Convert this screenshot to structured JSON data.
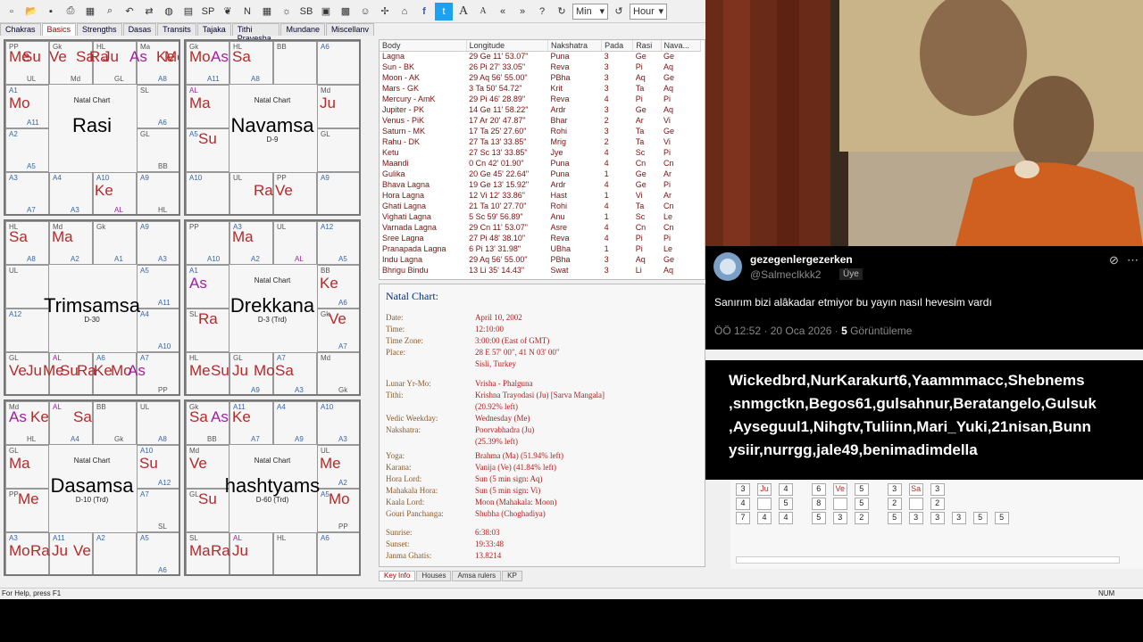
{
  "toolbar": {
    "min_select": "Min",
    "hour_select": "Hour",
    "buttons": [
      "new-icon",
      "open-icon",
      "save-icon",
      "print-icon",
      "palette-icon",
      "search-icon",
      "undo-icon",
      "compare-icon",
      "globe-icon",
      "grid-icon",
      "sp-kb-icon",
      "leaf-icon",
      "n-icon",
      "table-icon",
      "sun-icon",
      "sb-icon",
      "frame-icon",
      "pattern-icon",
      "people-icon",
      "pinwheel-icon",
      "house-icon",
      "facebook-icon",
      "twitter-icon",
      "font-large-icon",
      "font-small-icon",
      "rewind-icon",
      "forward-icon",
      "help-icon",
      "cycle-icon",
      "cycle2-icon"
    ]
  },
  "tabs": [
    "Chakras",
    "Basics",
    "Strengths",
    "Dasas",
    "Transits",
    "Tajaka",
    "Tithi Pravesha",
    "Mundane",
    "Miscellanv"
  ],
  "active_tab": "Basics",
  "charts": [
    {
      "title": "Natal Chart",
      "name": "Rasi",
      "sub": ""
    },
    {
      "title": "Natal Chart",
      "name": "Navamsa",
      "sub": "D-9"
    },
    {
      "title": "",
      "name": "Trimsamsa",
      "sub": "D-30"
    },
    {
      "title": "Natal Chart",
      "name": "Drekkana",
      "sub": "D-3 (Trd)"
    },
    {
      "title": "Natal Chart",
      "name": "Dasamsa",
      "sub": "D-10 (Trd)"
    },
    {
      "title": "Natal Chart",
      "name": "hashtyams",
      "sub": "D-60 (Trd)"
    }
  ],
  "chart_planets": {
    "c0": [
      [
        "0",
        "0",
        "Me",
        "big"
      ],
      [
        "0",
        "1",
        "Su",
        "big"
      ],
      [
        "0",
        "3",
        "Ve",
        "big"
      ],
      [
        "0",
        "5",
        "Sa",
        "big"
      ],
      [
        "0",
        "6",
        "Ra",
        "big"
      ],
      [
        "0",
        "7",
        "Ju",
        "big"
      ],
      [
        "0",
        "9",
        "As",
        "bigp"
      ],
      [
        "0",
        "11",
        "Ke",
        "big"
      ],
      [
        "0",
        "12",
        "Me",
        "big"
      ],
      [
        "1",
        "0",
        "Mo",
        "big"
      ],
      [
        "2",
        "4",
        "Ke",
        "big"
      ]
    ],
    "c1": [
      [
        "0",
        "0",
        "Mo",
        "big"
      ],
      [
        "0",
        "1",
        "As",
        "bigp"
      ],
      [
        "0",
        "2",
        "Sa",
        "big"
      ],
      [
        "1",
        "0",
        "Ma",
        "big"
      ],
      [
        "1",
        "1",
        "Ju",
        "big"
      ],
      [
        "1",
        "2",
        "Su",
        "big"
      ],
      [
        "2",
        "3",
        "Ra",
        "big"
      ],
      [
        "2",
        "4",
        "Ve",
        "big"
      ]
    ],
    "c2": [
      [
        "0",
        "0",
        "Sa",
        "big"
      ],
      [
        "0",
        "2",
        "Ma",
        "big"
      ],
      [
        "2",
        "0",
        "Ve",
        "big"
      ],
      [
        "2",
        "1",
        "Ju",
        "big"
      ],
      [
        "2",
        "2",
        "Me",
        "big"
      ],
      [
        "2",
        "3",
        "Su",
        "big"
      ],
      [
        "2",
        "4",
        "Ra",
        "big"
      ],
      [
        "2",
        "5",
        "Ke",
        "big"
      ],
      [
        "2",
        "6",
        "Mo",
        "big"
      ],
      [
        "2",
        "7",
        "As",
        "bigp"
      ]
    ],
    "c3": [
      [
        "0",
        "2",
        "Ma",
        "big"
      ],
      [
        "1",
        "0",
        "As",
        "bigp"
      ],
      [
        "1",
        "1",
        "Ke",
        "big"
      ],
      [
        "1",
        "2",
        "Ra",
        "big"
      ],
      [
        "1",
        "3",
        "Ve",
        "big"
      ],
      [
        "2",
        "0",
        "Me",
        "big"
      ],
      [
        "2",
        "1",
        "Su",
        "big"
      ],
      [
        "2",
        "2",
        "Ju",
        "big"
      ],
      [
        "2",
        "3",
        "Mo",
        "big"
      ],
      [
        "2",
        "4",
        "Sa",
        "big"
      ]
    ],
    "c4": [
      [
        "0",
        "0",
        "As",
        "bigp"
      ],
      [
        "0",
        "1",
        "Ke",
        "big"
      ],
      [
        "0",
        "3",
        "Sa",
        "big"
      ],
      [
        "1",
        "0",
        "Ma",
        "big"
      ],
      [
        "1",
        "1",
        "Su",
        "big"
      ],
      [
        "1",
        "2",
        "Me",
        "big"
      ],
      [
        "2",
        "0",
        "Mo",
        "big"
      ],
      [
        "2",
        "1",
        "Ra",
        "big"
      ],
      [
        "2",
        "2",
        "Ju",
        "big"
      ],
      [
        "2",
        "3",
        "Ve",
        "big"
      ]
    ],
    "c5": [
      [
        "0",
        "0",
        "Sa",
        "big"
      ],
      [
        "0",
        "1",
        "As",
        "bigp"
      ],
      [
        "0",
        "2",
        "Ke",
        "big"
      ],
      [
        "1",
        "0",
        "Ve",
        "big"
      ],
      [
        "1",
        "1",
        "Me",
        "big"
      ],
      [
        "1",
        "2",
        "Su",
        "big"
      ],
      [
        "1",
        "3",
        "Mo",
        "big"
      ],
      [
        "2",
        "0",
        "Ma",
        "big"
      ],
      [
        "2",
        "1",
        "Ra",
        "big"
      ],
      [
        "2",
        "2",
        "Ju",
        "big"
      ]
    ]
  },
  "chart_small": {
    "c0": [
      "PP",
      "Gk",
      "HL",
      "Ma",
      "SL",
      "GL",
      "A9",
      "A10",
      "A4",
      "A3",
      "A2",
      "A1",
      "UL",
      "Md",
      "GL",
      "A8",
      "A6",
      "BB",
      "HL",
      "AL",
      "A3",
      "A7",
      "A5",
      "A11"
    ],
    "c1": [
      "Gk",
      "HL",
      "BB",
      "A6",
      "Md",
      "GL",
      "A9",
      "PP",
      "UL",
      "A10",
      "A5",
      "AL",
      "A11",
      "A8"
    ],
    "c2": [
      "HL",
      "Md",
      "Gk",
      "A9",
      "A5",
      "A4",
      "A7",
      "A6",
      "AL",
      "GL",
      "A12",
      "UL",
      "A8",
      "A2",
      "A1",
      "A3",
      "A11",
      "A10",
      "PP"
    ],
    "c3": [
      "PP",
      "A3",
      "UL",
      "A12",
      "BB",
      "Gk",
      "Md",
      "A7",
      "GL",
      "HL",
      "SL",
      "A1",
      "A10",
      "A2",
      "AL",
      "A5",
      "A6",
      "A7",
      "Gk",
      "A3",
      "A9"
    ],
    "c4": [
      "Md",
      "AL",
      "BB",
      "UL",
      "A10",
      "A7",
      "A5",
      "A2",
      "A11",
      "A3",
      "PP",
      "GL",
      "HL",
      "A4",
      "Gk",
      "A8",
      "A12",
      "SL",
      "A6"
    ],
    "c5": [
      "Gk",
      "A11",
      "A4",
      "A10",
      "UL",
      "A5",
      "A6",
      "HL",
      "AL",
      "SL",
      "GL",
      "Md",
      "BB",
      "A7",
      "A9",
      "A3",
      "A2",
      "PP"
    ]
  },
  "table": {
    "headers": [
      "Body",
      "Longitude",
      "Nakshatra",
      "Pada",
      "Rasi",
      "Nava..."
    ],
    "rows": [
      [
        "Lagna",
        "29 Ge 11' 53.07\"",
        "Puna",
        "3",
        "Ge",
        "Ge"
      ],
      [
        "Sun - BK",
        "26 Pi 27' 33.05\"",
        "Reva",
        "3",
        "Pi",
        "Aq"
      ],
      [
        "Moon - AK",
        "29 Aq 56' 55.00\"",
        "PBha",
        "3",
        "Aq",
        "Ge"
      ],
      [
        "Mars - GK",
        "3 Ta 50' 54.72\"",
        "Krit",
        "3",
        "Ta",
        "Aq"
      ],
      [
        "Mercury - AmK",
        "29 Pi 46' 28.89\"",
        "Reva",
        "4",
        "Pi",
        "Pi"
      ],
      [
        "Jupiter - PK",
        "14 Ge 11' 58.22\"",
        "Ardr",
        "3",
        "Ge",
        "Aq"
      ],
      [
        "Venus - PiK",
        "17 Ar 20' 47.87\"",
        "Bhar",
        "2",
        "Ar",
        "Vi"
      ],
      [
        "Saturn - MK",
        "17 Ta 25' 27.60\"",
        "Rohi",
        "3",
        "Ta",
        "Ge"
      ],
      [
        "Rahu - DK",
        "27 Ta 13' 33.85\"",
        "Mrig",
        "2",
        "Ta",
        "Vi"
      ],
      [
        "Ketu",
        "27 Sc 13' 33.85\"",
        "Jye",
        "4",
        "Sc",
        "Pi"
      ],
      [
        "Maandi",
        "0 Cn 42' 01.90\"",
        "Puna",
        "4",
        "Cn",
        "Cn"
      ],
      [
        "Gulika",
        "20 Ge 45' 22.64\"",
        "Puna",
        "1",
        "Ge",
        "Ar"
      ],
      [
        "Bhava Lagna",
        "19 Ge 13' 15.92\"",
        "Ardr",
        "4",
        "Ge",
        "Pi"
      ],
      [
        "Hora Lagna",
        "12 Vi 12' 33.86\"",
        "Hast",
        "1",
        "Vi",
        "Ar"
      ],
      [
        "Ghati Lagna",
        "21 Ta 10' 27.70\"",
        "Rohi",
        "4",
        "Ta",
        "Cn"
      ],
      [
        "Vighati Lagna",
        "5 Sc 59' 56.89\"",
        "Anu",
        "1",
        "Sc",
        "Le"
      ],
      [
        "Varnada Lagna",
        "29 Cn 11' 53.07\"",
        "Asre",
        "4",
        "Cn",
        "Cn"
      ],
      [
        "Sree Lagna",
        "27 Pi 48' 38.10\"",
        "Reva",
        "4",
        "Pi",
        "Pi"
      ],
      [
        "Pranapada Lagna",
        "6 Pi 13' 31.98\"",
        "UBha",
        "1",
        "Pi",
        "Le"
      ],
      [
        "Indu Lagna",
        "29 Aq 56' 55.00\"",
        "PBha",
        "3",
        "Aq",
        "Ge"
      ],
      [
        "Bhrigu Bindu",
        "13 Li 35' 14.43\"",
        "Swat",
        "3",
        "Li",
        "Aq"
      ]
    ]
  },
  "info": {
    "title": "Natal Chart:",
    "rows": [
      [
        "Date:",
        "April 10, 2002"
      ],
      [
        "Time:",
        "12:10:00"
      ],
      [
        "Time Zone:",
        "3:00:00 (East of GMT)"
      ],
      [
        "Place:",
        "28 E 57' 00\", 41 N 03' 00\""
      ],
      [
        "",
        "Sisli, Turkey"
      ],
      [
        "Lunar Yr-Mo:",
        "Vrisha - Phalguna"
      ],
      [
        "Tithi:",
        "Krishna Trayodasi (Ju) [Sarva Mangala]"
      ],
      [
        "",
        "(20.92% left)"
      ],
      [
        "Vedic Weekday:",
        "Wednesday (Me)"
      ],
      [
        "Nakshatra:",
        "Poorvabhadra (Ju)"
      ],
      [
        "",
        "(25.39% left)"
      ],
      [
        "Yoga:",
        "Brahma (Ma) (51.94% left)"
      ],
      [
        "Karana:",
        "Vanija (Ve) (41.84% left)"
      ],
      [
        "Hora Lord:",
        "Sun (5 min sign: Aq)"
      ],
      [
        "Mahakala Hora:",
        "Sun (5 min sign: Vi)"
      ],
      [
        "Kaala Lord:",
        "Moon (Mahakala: Moon)"
      ],
      [
        "Gouri Panchanga:",
        "Shubha (Choghadiya)"
      ],
      [
        "Sunrise:",
        "6:38:03"
      ],
      [
        "Sunset:",
        "19:33:48"
      ],
      [
        "Janma Ghatis:",
        "13.8214"
      ]
    ]
  },
  "bottom_tabs": [
    "Key Info",
    "Houses",
    "Amsa rulers",
    "KP"
  ],
  "status": {
    "help": "For Help, press F1",
    "num": "NUM"
  },
  "tweet": {
    "name": "gezegenlergezerken",
    "handle": "@Salmeclkkk2",
    "badge": "Üye",
    "text": "Sanırım bizi alâkadar etmiyor bu yayın nasıl hevesim vardı",
    "meta": "ÖÖ 12:52 · 20 Oca 2026 · ",
    "views": "5",
    "views_label": " Görüntüleme"
  },
  "names": {
    "text": "Wickedbrd,NurKarakurt6,Yaammmacc,Shebnems ,snmgctkn,Begos61,gulsahnur,Beratangelo,Gulsuk ,Ayseguul1,Nihgtv,Tuliinn,Mari_Yuki,21nisan,Bunn ysiir,nurrgg,jale49,benimadimdella"
  },
  "right_grid": {
    "cells": [
      [
        "3",
        "Ju",
        "4",
        "6",
        "Ve",
        "5",
        "3",
        "Sa",
        "3"
      ],
      [
        "4",
        "",
        "5",
        "8",
        "",
        "5",
        "2",
        "",
        "2"
      ],
      [
        "7",
        "4",
        "4",
        "5",
        "3",
        "2",
        "5",
        "3",
        "3",
        "3",
        "5",
        "5"
      ]
    ]
  },
  "colors": {
    "planet": "#b22a2a",
    "ascendant": "#a020a0",
    "small": "#555555",
    "accent": "#003080"
  }
}
